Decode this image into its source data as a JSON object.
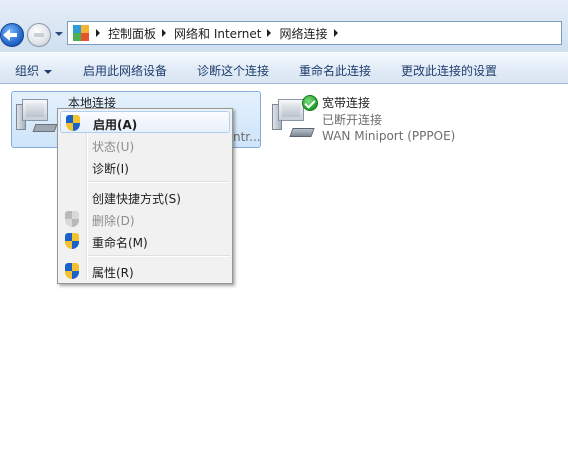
{
  "address": {
    "crumbs": [
      "控制面板",
      "网络和 Internet",
      "网络连接"
    ]
  },
  "command_bar": {
    "organize": "组织",
    "enable_device": "启用此网络设备",
    "diagnose": "诊断这个连接",
    "rename": "重命名此连接",
    "change_settings": "更改此连接的设置"
  },
  "connections": {
    "local": {
      "name": "本地连接",
      "device_fragment": "ntr..."
    },
    "broadband": {
      "name": "宽带连接",
      "status": "已断开连接",
      "device": "WAN Miniport (PPPOE)"
    }
  },
  "context_menu": {
    "items": [
      {
        "label": "启用(A)",
        "shield": true,
        "disabled": false,
        "default": true
      },
      {
        "label": "状态(U)",
        "shield": false,
        "disabled": true
      },
      {
        "label": "诊断(I)",
        "shield": false,
        "disabled": false
      },
      {
        "label": "创建快捷方式(S)",
        "shield": false,
        "disabled": false
      },
      {
        "label": "删除(D)",
        "shield": true,
        "disabled": true
      },
      {
        "label": "重命名(M)",
        "shield": true,
        "disabled": false
      },
      {
        "label": "属性(R)",
        "shield": true,
        "disabled": false
      }
    ]
  }
}
